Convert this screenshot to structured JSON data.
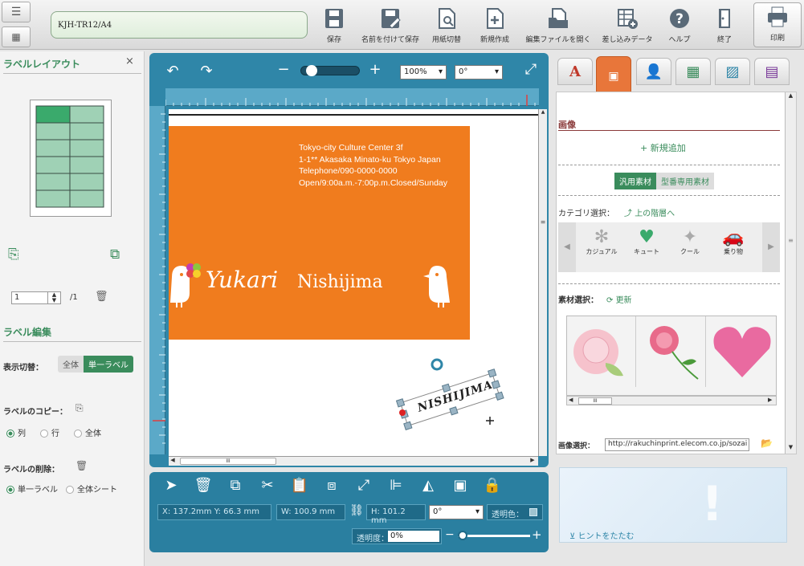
{
  "toolbar": {
    "doc_name": "KJH-TR12/A4",
    "tools": [
      {
        "label": "保存",
        "icon": "save-icon"
      },
      {
        "label": "名前を付けて保存",
        "icon": "save-as-icon"
      },
      {
        "label": "用紙切替",
        "icon": "paper-switch-icon"
      },
      {
        "label": "新規作成",
        "icon": "new-document-icon"
      },
      {
        "label": "編集ファイルを開く",
        "icon": "open-file-icon"
      },
      {
        "label": "差し込みデータ",
        "icon": "merge-data-icon"
      },
      {
        "label": "ヘルプ",
        "icon": "help-icon"
      },
      {
        "label": "終了",
        "icon": "exit-icon"
      }
    ],
    "print_label": "印刷"
  },
  "left": {
    "title": "ラベルレイアウト",
    "close": "×",
    "page_value": "1",
    "page_total": "/1",
    "edit_title": "ラベル編集",
    "display_switch_label": "表示切替：",
    "display_all": "全体",
    "display_single": "単一ラベル",
    "copy_label": "ラベルのコピー：",
    "copy_options": [
      "列",
      "行",
      "全体"
    ],
    "delete_label": "ラベルの削除：",
    "delete_options": [
      "単一ラベル",
      "全体シート"
    ]
  },
  "canvas": {
    "zoom": "100%",
    "rotation": "0°",
    "card": {
      "address_lines": [
        "Tokyo-city Culture Center 3f",
        "1-1** Akasaka Minato-ku Tokyo Japan",
        "Telephone/090-0000-0000",
        "Open/9:00a.m.-7:00p.m.Closed/Sunday"
      ],
      "name_script": "Yukari",
      "name_serif": "Nishijima",
      "selected_text": "NISHIJIMA",
      "card_color": "#f07c1e"
    },
    "scroll_marker": "III"
  },
  "props": {
    "x_label": "X:",
    "x_value": "137.2mm",
    "y_label": "Y:",
    "y_value": "66.3 mm",
    "w_label": "W:",
    "w_value": "100.9 mm",
    "h_label": "H:",
    "h_value": "101.2 mm",
    "rotation": "0°",
    "transparent_color_label": "透明色：",
    "opacity_label": "透明度：",
    "opacity_value": "0%"
  },
  "right": {
    "section_title": "画像",
    "add_new": "新規追加",
    "material_tabs": [
      "汎用素材",
      "型番専用素材"
    ],
    "category_label": "カテゴリ選択：",
    "up_level": "上の階層へ",
    "categories": [
      {
        "label": "カジュアル",
        "icon": "flower-icon"
      },
      {
        "label": "キュート",
        "icon": "heart-icon"
      },
      {
        "label": "クール",
        "icon": "sparkle-icon"
      },
      {
        "label": "乗り物",
        "icon": "car-icon"
      }
    ],
    "material_select_label": "素材選択：",
    "refresh": "更新",
    "material_thumbs": [
      "rose-outline-image",
      "rose-stem-image",
      "pink-heart-image"
    ],
    "scroll_marker": "III",
    "image_select_label": "画像選択：",
    "image_url": "http://rakuchinprint.elecom.co.jp/sozai",
    "hint_toggle": "ヒントをたたむ"
  },
  "colors": {
    "accent_green": "#3a8c5c",
    "panel_blue": "#2f86a8",
    "orange": "#f07c1e",
    "tab_active": "#e8763a"
  }
}
